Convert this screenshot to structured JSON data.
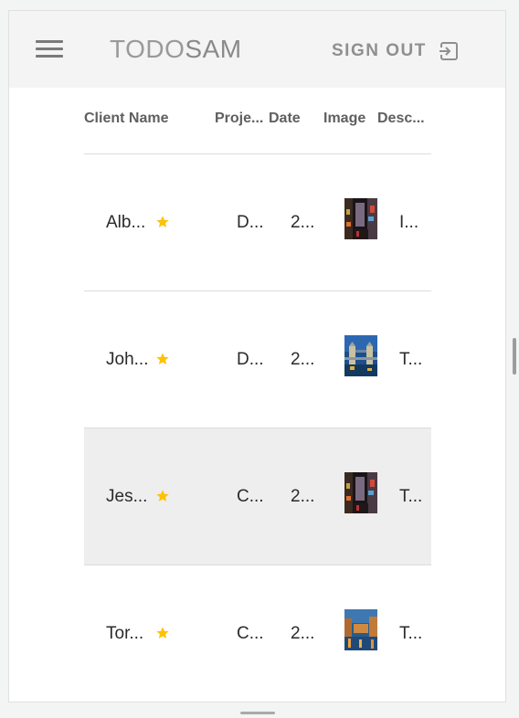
{
  "app": {
    "brand_part1": "TODO",
    "brand_part2": "SAM",
    "signout_label": "SIGN OUT"
  },
  "table": {
    "headers": [
      "Client Name",
      "Proje...",
      "Date",
      "Image",
      "Desc..."
    ],
    "rows": [
      {
        "client": "Alb...",
        "project": "D...",
        "date": "2...",
        "image": "city-night-street-photo",
        "description": "I...",
        "starred": true,
        "highlighted": false
      },
      {
        "client": "Joh...",
        "project": "D...",
        "date": "2...",
        "image": "tower-bridge-photo",
        "description": "T...",
        "starred": true,
        "highlighted": false
      },
      {
        "client": "Jes...",
        "project": "C...",
        "date": "2...",
        "image": "city-night-street-photo",
        "description": "T...",
        "starred": true,
        "highlighted": true
      },
      {
        "client": "Tor...",
        "project": "C...",
        "date": "2...",
        "image": "canal-sunset-photo",
        "description": "T...",
        "starred": true,
        "highlighted": false
      }
    ]
  },
  "colors": {
    "star": "#ffc107",
    "appbar_bg": "#f4f4f4",
    "highlight_row": "#eeeeee"
  }
}
